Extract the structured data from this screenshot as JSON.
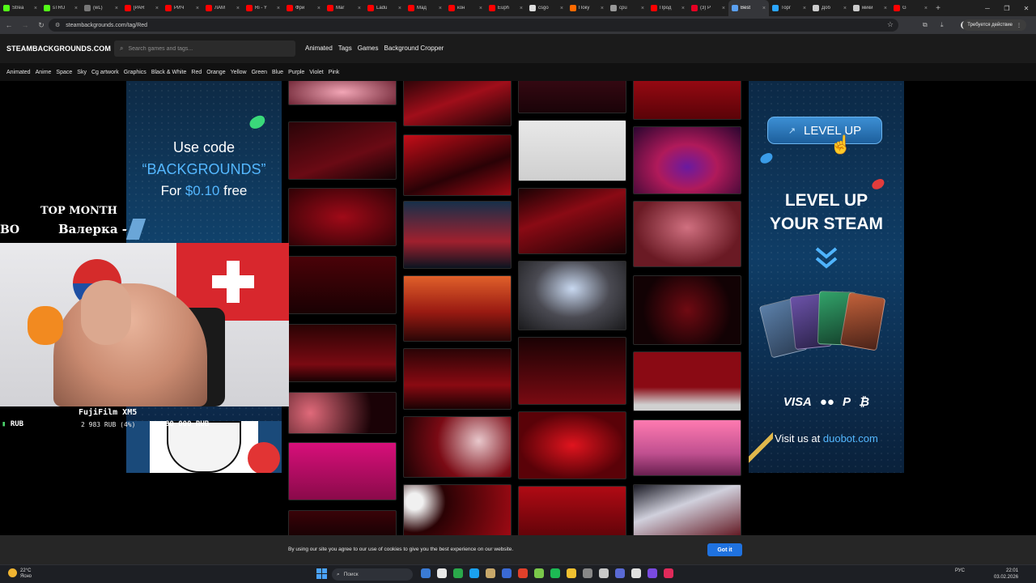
{
  "browser": {
    "tabs": [
      {
        "title": "Strea",
        "color": "#53fc18",
        "active": false
      },
      {
        "title": "sTRU",
        "color": "#53fc18",
        "active": false
      },
      {
        "title": "(wL)",
        "color": "#777777",
        "active": false
      },
      {
        "title": "[PAR",
        "color": "#ff0000",
        "active": false
      },
      {
        "title": "РИЧ",
        "color": "#ff0000",
        "active": false
      },
      {
        "title": "ЛАМ",
        "color": "#ff0000",
        "active": false
      },
      {
        "title": "Ri - Y",
        "color": "#ff0000",
        "active": false
      },
      {
        "title": "Фри",
        "color": "#ff0000",
        "active": false
      },
      {
        "title": "Mar",
        "color": "#ff0000",
        "active": false
      },
      {
        "title": "Ladu",
        "color": "#ff0000",
        "active": false
      },
      {
        "title": "Мад",
        "color": "#ff0000",
        "active": false
      },
      {
        "title": "кон",
        "color": "#ff0000",
        "active": false
      },
      {
        "title": "Euph",
        "color": "#ff0000",
        "active": false
      },
      {
        "title": "csgo",
        "color": "#dddddd",
        "active": false
      },
      {
        "title": "Поку",
        "color": "#ff6a00",
        "active": false
      },
      {
        "title": "cpu",
        "color": "#999999",
        "active": false
      },
      {
        "title": "Прод",
        "color": "#ff0000",
        "active": false
      },
      {
        "title": "(3) P",
        "color": "#e60023",
        "active": false
      },
      {
        "title": "Best",
        "color": "#5aa0f0",
        "active": true
      },
      {
        "title": "Торг",
        "color": "#2ba6ff",
        "active": false
      },
      {
        "title": "Доб",
        "color": "#cccccc",
        "active": false
      },
      {
        "title": "мики",
        "color": "#cccccc",
        "active": false
      },
      {
        "title": "G",
        "color": "#ff0000",
        "active": false
      }
    ],
    "url": "steambackgrounds.com/tag/Red",
    "required_action": "Требуется действие"
  },
  "site": {
    "logo": "STEAMBACKGROUNDS.COM",
    "search_placeholder": "Search games and tags...",
    "nav": [
      "Animated",
      "Tags",
      "Games",
      "Background Cropper"
    ],
    "tags": [
      "Animated",
      "Anime",
      "Space",
      "Sky",
      "Cg artwork",
      "Graphics",
      "Black & White",
      "Red",
      "Orange",
      "Yellow",
      "Green",
      "Blue",
      "Purple",
      "Violet",
      "Pink"
    ]
  },
  "ad_left": {
    "line1": "Use code",
    "line2": "“BACKGROUNDS”",
    "line3_prefix": "For ",
    "line3_price": "$0.10",
    "line3_suffix": " free"
  },
  "ad_right": {
    "button": "LEVEL UP",
    "headline1": "LEVEL UP",
    "headline2": "YOUR STEAM",
    "payments": [
      "VISA",
      "●●",
      "P",
      "₿"
    ],
    "visit_prefix": "Visit us at ",
    "visit_domain": "duobot.com"
  },
  "stream": {
    "top_month": "TOP MONTH",
    "donor": "Валерка - 2",
    "donor_left": "ВО",
    "goal_title": "FujiFilm XM5",
    "goal_current": "RUB",
    "goal_progress": "2 983 RUB (4%)",
    "goal_target": "80 000 RUB",
    "goal_fraction": 0.04
  },
  "cookie": {
    "message": "By using our site you agree to our use of cookies to give you the best experience on our website.",
    "button": "Got it"
  },
  "taskbar": {
    "temp": "22°C",
    "weather": "Ясно",
    "search": "Поиск",
    "lang": "РУС",
    "time": "22:01",
    "date": "03.02.2026"
  },
  "colors": {
    "accent_blue": "#54b7ff",
    "cookie_button": "#1f72e0"
  }
}
